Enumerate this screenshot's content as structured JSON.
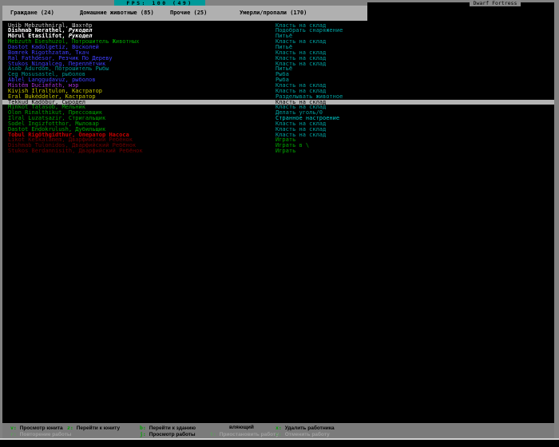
{
  "window": {
    "title": "Dwarf Fortress",
    "fps_label": "FPS: 100 (49)"
  },
  "tabs": [
    {
      "label": "Граждане (24)"
    },
    {
      "label": "Домашние животные (85)"
    },
    {
      "label": "Прочие (25)"
    },
    {
      "label": "Умерли/пропали (170)"
    }
  ],
  "units": [
    {
      "name": "Unib Mebzuthniral",
      "profession": "Шахтёр",
      "job": "Класть на склад",
      "name_color": "lightgray",
      "job_color": "teal"
    },
    {
      "name": "Dishmab Nerathel",
      "profession": "Рукодел",
      "job": "Подобрать снаряжение",
      "name_color": "white",
      "bold": true,
      "italic_profession": true,
      "job_color": "teal"
    },
    {
      "name": "Mörul Etasilifot",
      "profession": "Рукодел",
      "job": "Питьё",
      "name_color": "white",
      "bold": true,
      "italic_profession": true,
      "job_color": "teal"
    },
    {
      "name": "Mebzuth Eseshuzol",
      "profession": "Потрошитель Животных",
      "job": "Класть на склад",
      "name_color": "green",
      "job_color": "teal"
    },
    {
      "name": "Dastot Kadolgetiz",
      "profession": "Восколей",
      "job": "Питьё",
      "name_color": "blue",
      "job_color": "teal"
    },
    {
      "name": "Bomrek Rigothzatam",
      "profession": "Ткач",
      "job": "Класть на склад",
      "name_color": "blue",
      "job_color": "teal"
    },
    {
      "name": "Ral Fathdesor",
      "profession": "Резчик По Дереву",
      "job": "Класть на склад",
      "name_color": "blue",
      "job_color": "teal"
    },
    {
      "name": "Stukos Ningalceg",
      "profession": "Переплётчик",
      "job": "Класть на склад",
      "name_color": "blue",
      "job_color": "teal"
    },
    {
      "name": "Asob Adurdom",
      "profession": "Потрошитель Рыбы",
      "job": "Питьё",
      "name_color": "darkteal",
      "job_color": "teal"
    },
    {
      "name": "Ceg Mosusastel",
      "profession": "рыболов",
      "job": "Рыба",
      "name_color": "darkteal",
      "job_color": "teal"
    },
    {
      "name": "Àblel Langgudavuz",
      "profession": "рыболов",
      "job": "Рыба",
      "name_color": "blue",
      "job_color": "teal"
    },
    {
      "name": "Mistêm Ducimfath",
      "profession": "мэр",
      "job": "Класть на склад",
      "name_color": "purple",
      "job_color": "teal"
    },
    {
      "name": "Kivish Ilraltulon",
      "profession": "Кастратор",
      "job": "Класть на склад",
      "name_color": "yellow",
      "job_color": "teal"
    },
    {
      "name": "Eral Bukéddeler",
      "profession": "Кастратор",
      "job": "Разделывать животное",
      "name_color": "yellow",
      "job_color": "teal"
    },
    {
      "name": "Tekkud Kadôbür",
      "profession": "Сыродел",
      "job": "Класть на склад",
      "name_color": "black",
      "job_color": "black",
      "selected": true
    },
    {
      "name": "Minkot Tatasob",
      "profession": "Мельник",
      "job": "Класть на склад",
      "name_color": "green",
      "job_color": "teal"
    },
    {
      "name": "Olon Rinalthikut",
      "profession": "Прессовщик",
      "job": "Делать уголь/0",
      "name_color": "green",
      "job_color": "teal"
    },
    {
      "name": "Ilral Luzatsazir",
      "profession": "Стригальщик",
      "job": "Странное настроение",
      "name_color": "green",
      "job_color": "brightteal"
    },
    {
      "name": "Sodel Ingizfotthor",
      "profession": "Мыловар",
      "job": "Класть на склад",
      "name_color": "green",
      "job_color": "teal"
    },
    {
      "name": "Dastot Endokrulush",
      "profession": "Дубильщик",
      "job": "Класть на склад",
      "name_color": "green",
      "job_color": "teal"
    },
    {
      "name": "Tobul Rigôthgidthur",
      "profession": "Оператор Насоса",
      "job": "Класть на склад",
      "name_color": "brightred",
      "bold": true,
      "job_color": "teal"
    },
    {
      "name": "Likot Keskalamem",
      "profession": "Дварфийский Ребёнок",
      "job": "Играть",
      "name_color": "darkred",
      "job_color": "green"
    },
    {
      "name": "Dishmab Tulonidos",
      "profession": "Дварфийский Ребёнок",
      "job": "Играть в \\",
      "name_color": "darkred",
      "job_color": "green"
    },
    {
      "name": "Stukos Berdannisith",
      "profession": "Дварфийский Ребёнок",
      "job": "Играть",
      "name_color": "darkred",
      "job_color": "green"
    }
  ],
  "keybar": {
    "line1": [
      {
        "key": "v",
        "label": "Просмотр юнита",
        "enabled": true
      },
      {
        "key": "z",
        "label": "Перейти к юниту",
        "enabled": true
      },
      {
        "key": "b",
        "label": "Перейти к зданию",
        "enabled": true
      },
      {
        "key": "",
        "label": "вляющий",
        "enabled": true
      },
      {
        "key": "x",
        "label": "Удалить работника",
        "enabled": true
      }
    ],
    "line2": [
      {
        "key": "r",
        "label": "Повторение работы",
        "enabled": false
      },
      {
        "key": "j",
        "label": "Просмотр работы",
        "enabled": true
      },
      {
        "key": "t",
        "label": "Приостановить работу",
        "enabled": false
      },
      {
        "key": "c",
        "label": "Отменить работу",
        "enabled": false
      }
    ]
  },
  "colors": {
    "lightgray": "#c8c8c8",
    "white": "#ffffff",
    "green": "#00a300",
    "blue": "#3f3fff",
    "darkteal": "#008f8f",
    "purple": "#a030d0",
    "yellow": "#c6c600",
    "brightred": "#c80000",
    "darkred": "#700000",
    "teal": "#00a0a0",
    "brightteal": "#00c8c8",
    "black": "#000000",
    "fps_accent": "#009a9a",
    "key_green": "#00a000",
    "disabled_text": "#a2a2a2",
    "disabled_key": "#5f9b5f",
    "enabled_text": "#000000"
  }
}
